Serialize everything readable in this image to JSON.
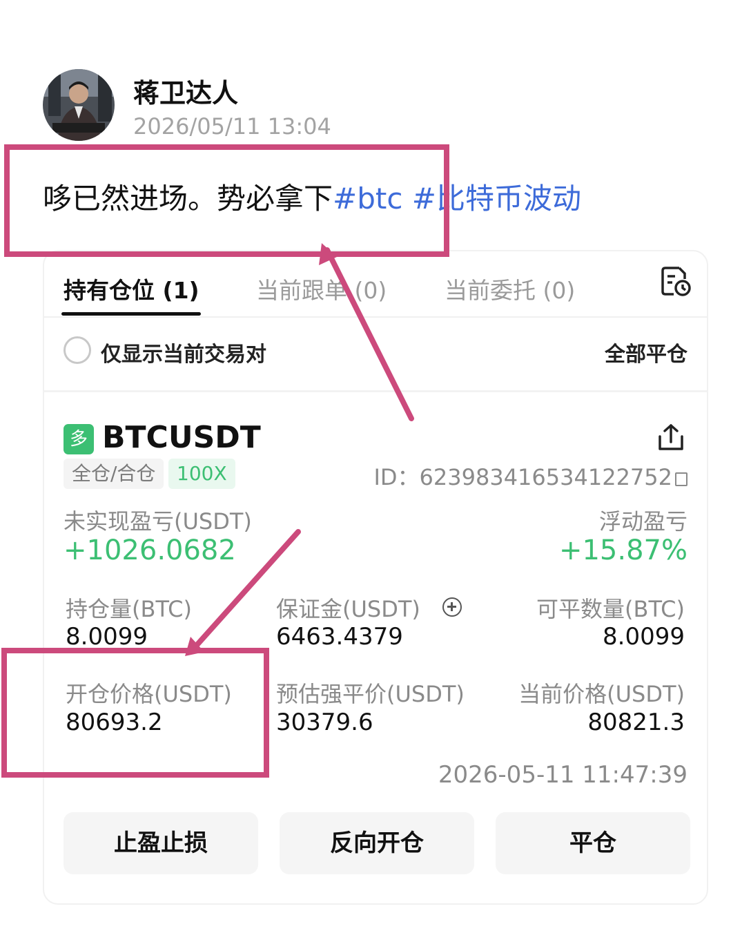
{
  "post": {
    "username": "蒋卫达人",
    "time": "2026/05/11 13:04",
    "text": "哆已然进场。势必拿下",
    "hashtags": [
      "#btc",
      "#比特币波动"
    ]
  },
  "tabs": [
    {
      "label": "持有仓位 (1)",
      "active": true
    },
    {
      "label": "当前跟单 (0)",
      "active": false
    },
    {
      "label": "当前委托 (0)",
      "active": false
    }
  ],
  "filter": {
    "label": "仅显示当前交易对",
    "close_all": "全部平仓"
  },
  "position": {
    "side_badge": "多",
    "symbol": "BTCUSDT",
    "margin_mode": "全仓/合仓",
    "leverage": "100X",
    "id_label": "ID：",
    "id_value": "623983416534122752",
    "unrealized_pnl_label": "未实现盈亏(USDT)",
    "unrealized_pnl": "+1026.0682",
    "float_pnl_label": "浮动盈亏",
    "float_pnl": "+15.87%",
    "size_label": "持仓量(BTC)",
    "size": "8.0099",
    "margin_label": "保证金(USDT)",
    "margin": "6463.4379",
    "closable_label": "可平数量(BTC)",
    "closable": "8.0099",
    "entry_price_label": "开仓价格(USDT)",
    "entry_price": "80693.2",
    "liq_price_label": "预估强平价(USDT)",
    "liq_price": "30379.6",
    "mark_price_label": "当前价格(USDT)",
    "mark_price": "80821.3",
    "open_time": "2026-05-11 11:47:39"
  },
  "actions": {
    "tpsl": "止盈止损",
    "reverse": "反向开仓",
    "close": "平仓"
  },
  "colors": {
    "profit_green": "#3cbf73",
    "hashtag_blue": "#3d6bd9",
    "annotation_pink": "#cc4a7c"
  }
}
